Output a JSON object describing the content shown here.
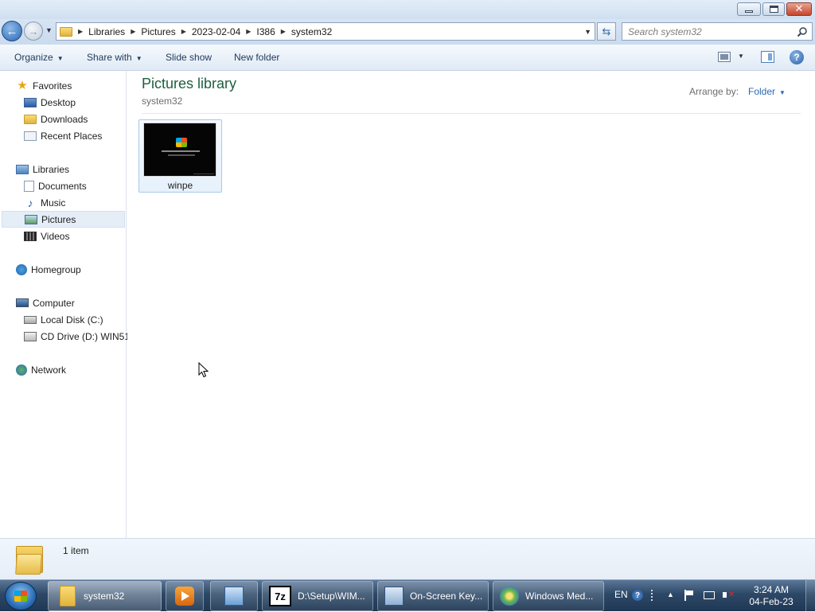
{
  "window": {
    "minimize_glyph": "—",
    "maximize_glyph": "",
    "close_glyph": "✕"
  },
  "address": {
    "breadcrumb": [
      "Libraries",
      "Pictures",
      "2023-02-04",
      "I386",
      "system32"
    ],
    "search_placeholder": "Search system32"
  },
  "toolbar": {
    "organize": "Organize",
    "share_with": "Share with",
    "slide_show": "Slide show",
    "new_folder": "New folder"
  },
  "nav": {
    "favorites": "Favorites",
    "desktop": "Desktop",
    "downloads": "Downloads",
    "recent_places": "Recent Places",
    "libraries": "Libraries",
    "documents": "Documents",
    "music": "Music",
    "pictures": "Pictures",
    "videos": "Videos",
    "homegroup": "Homegroup",
    "computer": "Computer",
    "local_disk": "Local Disk (C:)",
    "cd_drive": "CD Drive (D:) WIN51",
    "network": "Network"
  },
  "content": {
    "title": "Pictures library",
    "subtitle": "system32",
    "arrange_by_label": "Arrange by:",
    "arrange_by_value": "Folder",
    "files": [
      {
        "name": "winpe",
        "type": "image"
      }
    ]
  },
  "details": {
    "item_count": "1 item"
  },
  "taskbar": {
    "tasks": [
      {
        "label": "system32",
        "icon": "folder-icon",
        "active": true
      },
      {
        "label": "",
        "icon": "media-player-icon"
      },
      {
        "label": "",
        "icon": "control-panel-icon"
      },
      {
        "label": "D:\\Setup\\WIM...",
        "icon": "7zip-icon",
        "icon_text": "7z"
      },
      {
        "label": "On-Screen Key...",
        "icon": "keyboard-icon"
      },
      {
        "label": "Windows Med...",
        "icon": "windows-media-icon"
      }
    ],
    "tray": {
      "language": "EN",
      "time": "3:24 AM",
      "date": "04-Feb-23"
    }
  },
  "colors": {
    "library_title": "#1e5f3d",
    "link_blue": "#2d68b0",
    "taskbar": "#2d4867"
  }
}
